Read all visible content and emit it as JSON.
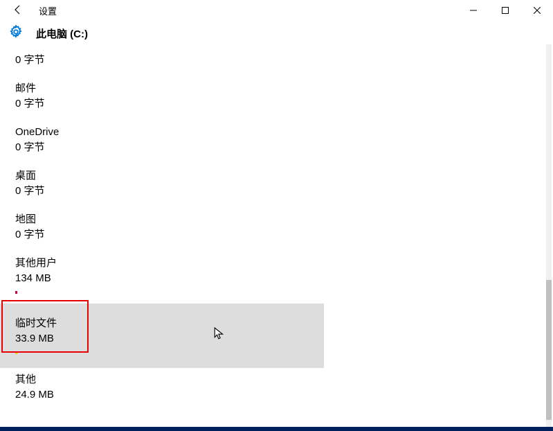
{
  "window": {
    "title": "设置",
    "header": "此电脑 (C:)"
  },
  "items": [
    {
      "title": "",
      "size": "0 字节"
    },
    {
      "title": "邮件",
      "size": "0 字节"
    },
    {
      "title": "OneDrive",
      "size": "0 字节"
    },
    {
      "title": "桌面",
      "size": "0 字节"
    },
    {
      "title": "地图",
      "size": "0 字节"
    },
    {
      "title": "其他用户",
      "size": "134 MB"
    },
    {
      "title": "临时文件",
      "size": "33.9 MB"
    },
    {
      "title": "其他",
      "size": "24.9 MB"
    }
  ]
}
